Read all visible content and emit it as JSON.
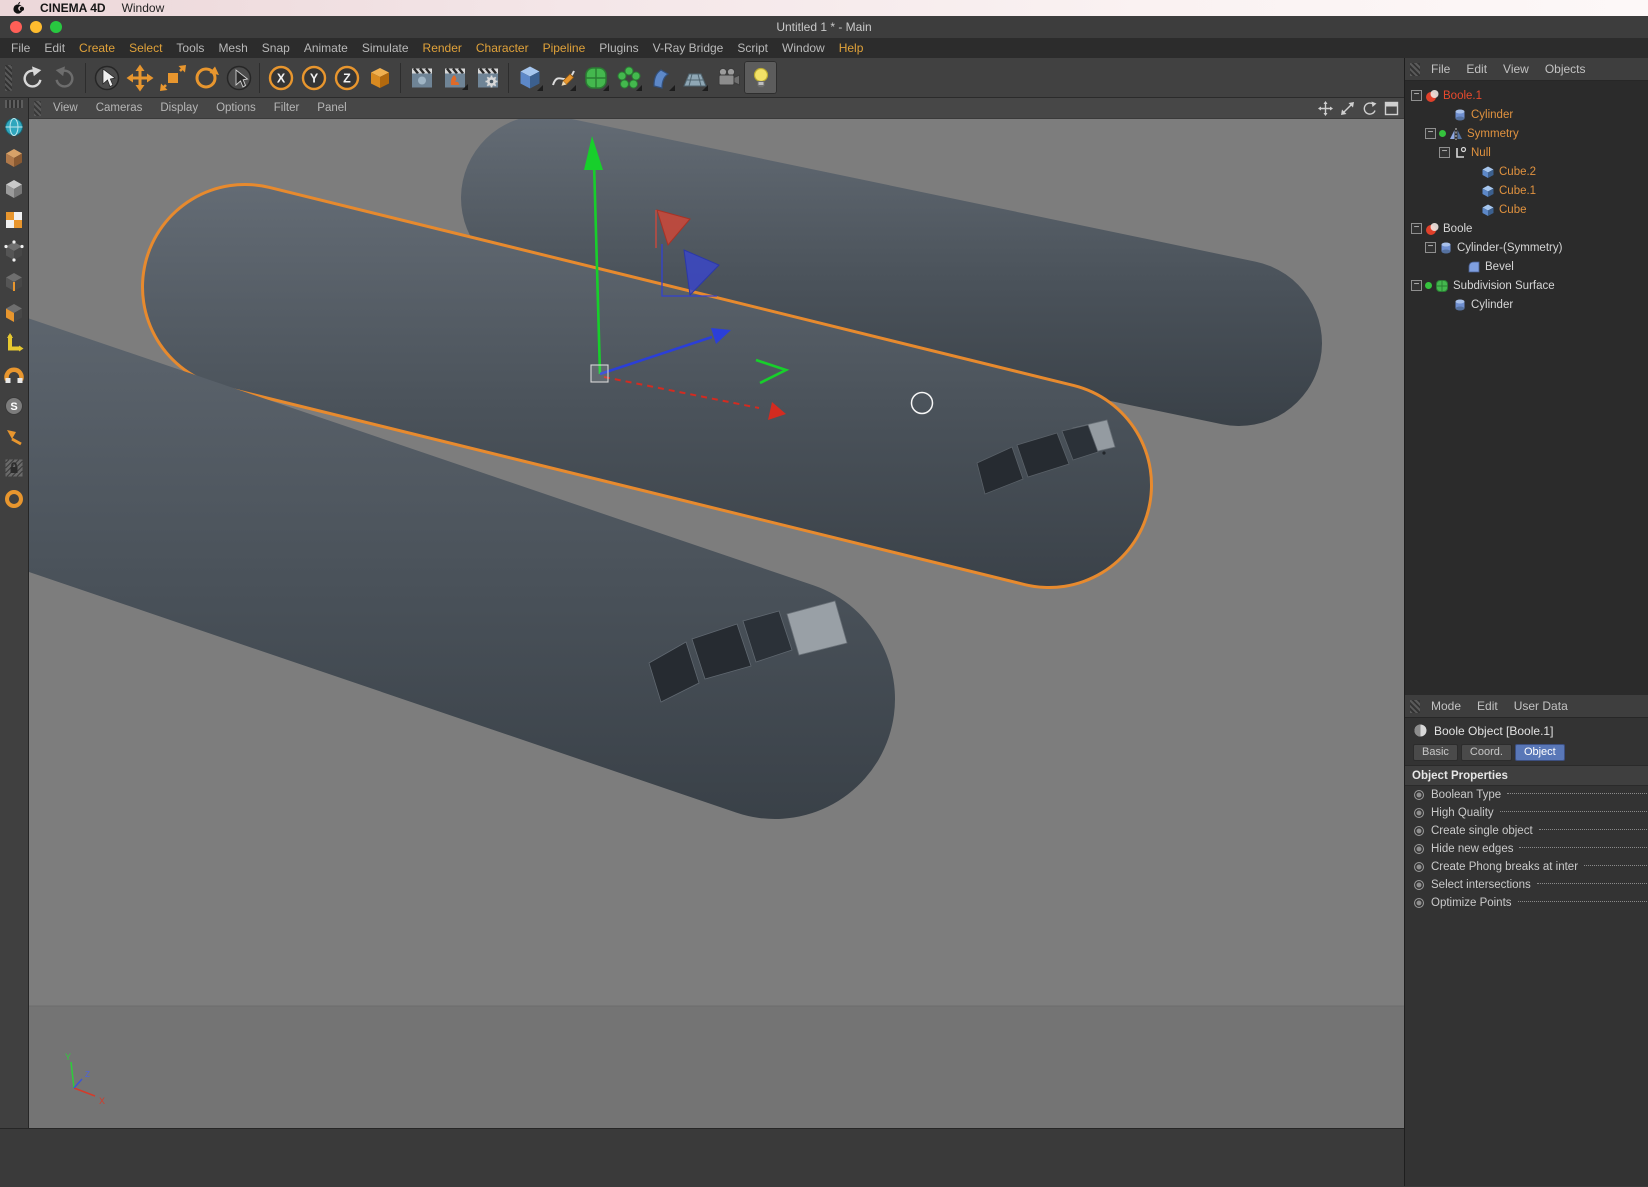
{
  "colors": {
    "accent_orange": "#e8962e",
    "selection_outline": "#e78a2e",
    "selected_tree_text": "#e84a2e",
    "tree_orange_text": "#e0923f",
    "active_tab_blue": "#5977b7",
    "viewport_gray": "#7d7d7d",
    "fuselage_dark": "#4a525a"
  },
  "macos_menubar": {
    "app_name": "CINEMA 4D",
    "menu_items": [
      "Window"
    ]
  },
  "titlebar": {
    "title": "Untitled 1 * - Main"
  },
  "menubar": {
    "items": [
      {
        "label": "File"
      },
      {
        "label": "Edit"
      },
      {
        "label": "Create",
        "accent": true
      },
      {
        "label": "Select",
        "accent": true
      },
      {
        "label": "Tools"
      },
      {
        "label": "Mesh"
      },
      {
        "label": "Snap"
      },
      {
        "label": "Animate"
      },
      {
        "label": "Simulate"
      },
      {
        "label": "Render",
        "accent": true
      },
      {
        "label": "Character",
        "accent": true
      },
      {
        "label": "Pipeline",
        "accent": true
      },
      {
        "label": "Plugins"
      },
      {
        "label": "V-Ray Bridge"
      },
      {
        "label": "Script"
      },
      {
        "label": "Window"
      },
      {
        "label": "Help",
        "accent": true
      }
    ]
  },
  "toolbar": {
    "tools": [
      "undo",
      "redo",
      "live-selection",
      "move",
      "scale",
      "rotate",
      "last-tool",
      "lock-x-axis",
      "lock-y-axis",
      "lock-z-axis",
      "coordinate-system",
      "render-view",
      "render-to-picture-viewer",
      "edit-render-settings",
      "add-cube-primitive",
      "spline-pen",
      "subdivision-surface",
      "generators",
      "deformers",
      "environment",
      "camera",
      "light"
    ],
    "axis_buttons": {
      "x": "X",
      "y": "Y",
      "z": "Z"
    }
  },
  "left_palette": {
    "tools": [
      "convert",
      "make-editable",
      "model-mode",
      "texture-mode",
      "points-mode",
      "edges-mode",
      "polygons-mode",
      "enable-axis",
      "workplane",
      "snapping",
      "snap-settings",
      "locked-workplane",
      "texture-axis"
    ]
  },
  "viewport": {
    "menu_items": [
      "View",
      "Cameras",
      "Display",
      "Options",
      "Filter",
      "Panel"
    ],
    "axis_labels": {
      "x": "X",
      "y": "Y",
      "z": "Z"
    }
  },
  "object_manager": {
    "menu_items": [
      "File",
      "Edit",
      "View",
      "Objects"
    ],
    "tree": [
      {
        "label": "Boole.1"
      },
      {
        "label": "Cylinder"
      },
      {
        "label": "Symmetry"
      },
      {
        "label": "Null"
      },
      {
        "label": "Cube.2"
      },
      {
        "label": "Cube.1"
      },
      {
        "label": "Cube"
      },
      {
        "label": "Boole"
      },
      {
        "label": "Cylinder-(Symmetry)"
      },
      {
        "label": "Bevel"
      },
      {
        "label": "Subdivision Surface"
      },
      {
        "label": "Cylinder"
      }
    ]
  },
  "attribute_manager": {
    "menu_items": [
      "Mode",
      "Edit",
      "User Data"
    ],
    "object_title": "Boole Object [Boole.1]",
    "tabs": [
      "Basic",
      "Coord.",
      "Object"
    ],
    "active_tab": "Object",
    "section_title": "Object Properties",
    "properties": [
      "Boolean Type",
      "High Quality",
      "Create single object",
      "Hide new edges",
      "Create Phong breaks at inter",
      "Select intersections",
      "Optimize Points"
    ]
  }
}
